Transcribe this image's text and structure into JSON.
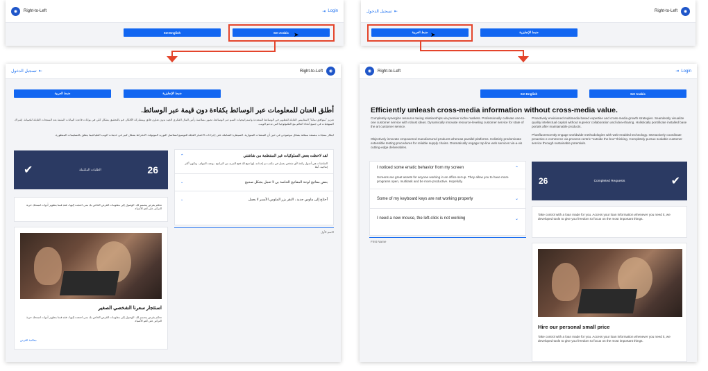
{
  "brand_name": "Right-to-Left",
  "login_label": "Login",
  "login_label_ar": "تسجيل الدخول",
  "btn_set_english": "Set English",
  "btn_set_arabic": "Set Arabic",
  "btn_set_english_ar": "ضبط الإنجليزية",
  "btn_set_arabic_ar": "ضبط العربية",
  "en": {
    "title": "Efficiently unleash cross-media information without cross-media value.",
    "col1_p1": "Completely synergize resource taxing relationships via premier niche markets. Professionally cultivate one-to-one customer service with robust ideas. Dynamically innovate resource-leveling customer service for state of the art customer service.",
    "col1_p2": "Objectively innovate empowered manufactured products whereas parallel platforms. Holisticly predominate extensible testing procedures for reliable supply chains. Dramatically engage top-line web services vis-a-vis cutting-edge deliverables.",
    "col2_p1": "Proactively envisioned multimedia based expertise and cross-media growth strategies. Seamlessly visualize quality intellectual capital without superior collaboration and idea-sharing. Holistically pontificate installed base portals after maintainable products.",
    "col2_p2": "Phosfluorescently engage worldwide methodologies with web-enabled technology. Interactively coordinate proactive e-commerce via process-centric \"outside the box\" thinking. Completely pursue scalable customer service through sustainable potentials.",
    "acc1_title": "I noticed some erratic behavior from my screen",
    "acc1_body": "Screens are great assets for anyone working in an office set up. They allow you to have more programs open, multitask and be more productive. Hopefully.",
    "acc2_title": "Some of my keyboard keys are not working properly",
    "acc3_title": "I need a new mouse, the left-click is not working",
    "first_name": "First Name",
    "stat_number": "26",
    "stat_label": "Completed Requests",
    "loan_text": "Take control with a loan made for you. Access your loan information whenever you need it, we developed tools to give you freedom to focus on the most important things.",
    "card_title": "Hire our personal small price",
    "card_text": "Take control with a loan made for you. Access your loan information whenever you need it, we developed tools to give you freedom to focus on the most important things."
  },
  "ar": {
    "title": "أطلق العنان للمعلومات عبر الوسائط بكفاءة دون قيمة عبر الوسائط.",
    "p1": "تعزيز \"متوافق تمامًا\" المقاييس القابلة للتطوير في الوسائط المتعددة واستراتيجيات النمو عبر الوسائط. تصور بسلاسة رأس المال الفكري الجيد بدون تعاون فائق ومشاركة الأفكار. قم بالتحقيق بشكل كلي في بوابات قاعدة البيانات المثبتة بعد المنتجات القابلة للصيانة. إشراك المنهجيات في جميع أنحاء العالم مع التكنولوجيا التي تدعم الويب.",
    "p2": "ابتكار منتجات مصنعة ممكنة بشكل موضوعي في حين أن المنصات المتوازية. السيطرة الشاملة على إجراءات الاختبار القابلة للتوسيع لسلاسل التوريد الموثوقة. الانخراط بشكل كبير في خدمات الويب العليا فيما يتعلق بالتسليمات المتطورة.",
    "acc1_title": "لقد لاحظت بعض السلوكيات غير المنتظمة من شاشتي",
    "acc1_body": "الشاشات هي أصول رائعة لأي شخص يعمل في مكتب تم إعداده. إنها تتيح لك فتح المزيد من البرامج ، وتعدد المهام ، وتكون أكثر إنتاجية. آملا",
    "acc2_title": "بعض مفاتيح لوحة المفاتيح الخاصة بي لا تعمل بشكل صحيح",
    "acc3_title": "أحتاج إلى ماوس جديد ، النقر بزر الماوس الأيسر لا يعمل",
    "first_name": "الاسم الأول",
    "stat_number": "26",
    "stat_label": "الطلبات المكتملة",
    "loan_text": "تحكم بقرض مصمم لك. الوصول إلى معلومات القرض الخاص بك متى احتجت إليها ، فقد قمنا بتطوير أدوات لتمنحك حرية التركيز على أهم الأشياء.",
    "card_title": "استئجار سعرنا الشخصي الصغير",
    "card_text": "تحكم بقرض مصمم لك. الوصول إلى معلومات القرض الخاص بك متى احتجت إليها ، فقد قمنا بتطوير أدوات لتمنحك حرية التركيز على أهم الأشياء.",
    "card_link": "معالجة القرض"
  },
  "colors": {
    "primary": "#1266f1",
    "stat_bg": "#2b3a63",
    "highlight": "#e4442b"
  }
}
